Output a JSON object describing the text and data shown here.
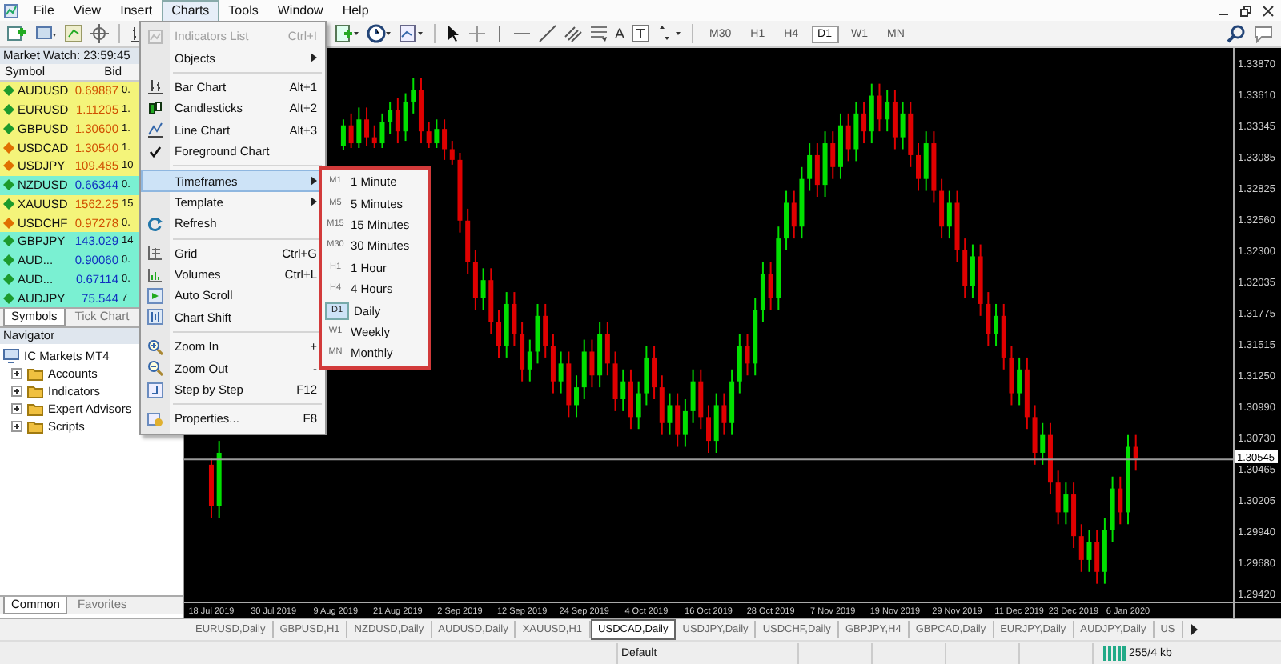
{
  "menu_bar": [
    {
      "label": "File",
      "selected": false
    },
    {
      "label": "View",
      "selected": false
    },
    {
      "label": "Insert",
      "selected": false
    },
    {
      "label": "Charts",
      "selected": true
    },
    {
      "label": "Tools",
      "selected": false
    },
    {
      "label": "Window",
      "selected": false
    },
    {
      "label": "Help",
      "selected": false
    }
  ],
  "toolbar": {
    "text_tool": "A",
    "timeframes": [
      {
        "label": "M30",
        "selected": false
      },
      {
        "label": "H1",
        "selected": false
      },
      {
        "label": "H4",
        "selected": false
      },
      {
        "label": "D1",
        "selected": true
      },
      {
        "label": "W1",
        "selected": false
      },
      {
        "label": "MN",
        "selected": false
      }
    ]
  },
  "market_watch": {
    "title": "Market Watch: 23:59:45",
    "columns": [
      "Symbol",
      "Bid"
    ],
    "rows": [
      {
        "symbol": "AUDUSD",
        "bid": "0.69887",
        "ask": "0.",
        "color": "#f4f47a",
        "marker": {
          "color": "#1c9a2c"
        }
      },
      {
        "symbol": "EURUSD",
        "bid": "1.11205",
        "ask": "1.",
        "color": "#f4f47a",
        "marker": {
          "color": "#1c9a2c"
        }
      },
      {
        "symbol": "GBPUSD",
        "bid": "1.30600",
        "ask": "1.",
        "color": "#f4f47a",
        "marker": {
          "color": "#1c9a2c"
        }
      },
      {
        "symbol": "USDCAD",
        "bid": "1.30540",
        "ask": "1.",
        "color": "#f4f47a",
        "marker": {
          "color": "#e07000"
        }
      },
      {
        "symbol": "USDJPY",
        "bid": "109.485",
        "ask": "10",
        "color": "#f4f47a",
        "marker": {
          "color": "#e07000"
        }
      },
      {
        "symbol": "NZDUSD",
        "bid": "0.66344",
        "ask": "0.",
        "color": "#7af0d2",
        "marker": {
          "color": "#1c9a2c"
        }
      },
      {
        "symbol": "XAUUSD",
        "bid": "1562.25",
        "ask": "15",
        "color": "#f4f47a",
        "marker": {
          "color": "#1c9a2c"
        }
      },
      {
        "symbol": "USDCHF",
        "bid": "0.97278",
        "ask": "0.",
        "color": "#f4f47a",
        "marker": {
          "color": "#e07000"
        }
      },
      {
        "symbol": "GBPJPY",
        "bid": "143.029",
        "ask": "14",
        "color": "#7af0d2",
        "marker": {
          "color": "#1c9a2c"
        }
      },
      {
        "symbol": "AUD...",
        "bid": "0.90060",
        "ask": "0.",
        "color": "#7af0d2",
        "marker": {
          "color": "#1c9a2c"
        }
      },
      {
        "symbol": "AUD...",
        "bid": "0.67114",
        "ask": "0.",
        "color": "#7af0d2",
        "marker": {
          "color": "#1c9a2c"
        }
      },
      {
        "symbol": "AUDJPY",
        "bid": "75.544",
        "ask": "7",
        "color": "#7af0d2",
        "marker": {
          "color": "#1c9a2c"
        }
      }
    ],
    "tabs": [
      {
        "label": "Symbols",
        "selected": true
      },
      {
        "label": "Tick Chart",
        "selected": false
      }
    ]
  },
  "navigator": {
    "title": "Navigator",
    "tree": [
      {
        "label": "IC Markets MT4",
        "children": [
          {
            "label": "Accounts",
            "expanded": false
          },
          {
            "label": "Indicators",
            "expanded": false
          },
          {
            "label": "Expert Advisors",
            "expanded": false
          },
          {
            "label": "Scripts",
            "expanded": false
          }
        ]
      }
    ],
    "tabs": [
      {
        "label": "Common",
        "selected": true
      },
      {
        "label": "Favorites",
        "selected": false
      }
    ]
  },
  "charts_menu": [
    {
      "kind": "item",
      "label": "Indicators List",
      "shortcut": "Ctrl+I",
      "disabled": true,
      "checked": false,
      "selected": false,
      "submenu": false
    },
    {
      "kind": "item",
      "label": "Objects",
      "disabled": false,
      "checked": false,
      "selected": false,
      "submenu": true
    },
    {
      "kind": "separator"
    },
    {
      "kind": "item",
      "label": "Bar Chart",
      "shortcut": "Alt+1",
      "disabled": false,
      "checked": false,
      "selected": false,
      "submenu": false
    },
    {
      "kind": "item",
      "label": "Candlesticks",
      "shortcut": "Alt+2",
      "disabled": false,
      "checked": false,
      "selected": false,
      "submenu": false
    },
    {
      "kind": "item",
      "label": "Line Chart",
      "shortcut": "Alt+3",
      "disabled": false,
      "checked": false,
      "selected": false,
      "submenu": false
    },
    {
      "kind": "item",
      "label": "Foreground Chart",
      "disabled": false,
      "checked": true,
      "selected": false,
      "submenu": false
    },
    {
      "kind": "separator"
    },
    {
      "kind": "item",
      "label": "Timeframes",
      "disabled": false,
      "checked": false,
      "selected": true,
      "submenu": true
    },
    {
      "kind": "item",
      "label": "Template",
      "disabled": false,
      "checked": false,
      "selected": false,
      "submenu": true
    },
    {
      "kind": "item",
      "label": "Refresh",
      "disabled": false,
      "checked": false,
      "selected": false,
      "submenu": false
    },
    {
      "kind": "separator"
    },
    {
      "kind": "item",
      "label": "Grid",
      "shortcut": "Ctrl+G",
      "disabled": false,
      "checked": false,
      "selected": false,
      "submenu": false
    },
    {
      "kind": "item",
      "label": "Volumes",
      "shortcut": "Ctrl+L",
      "disabled": false,
      "checked": false,
      "selected": false,
      "submenu": false
    },
    {
      "kind": "item",
      "label": "Auto Scroll",
      "disabled": false,
      "checked": false,
      "selected": false,
      "submenu": false
    },
    {
      "kind": "item",
      "label": "Chart Shift",
      "disabled": false,
      "checked": false,
      "selected": false,
      "submenu": false
    },
    {
      "kind": "separator"
    },
    {
      "kind": "item",
      "label": "Zoom In",
      "shortcut": "+",
      "disabled": false,
      "checked": false,
      "selected": false,
      "submenu": false
    },
    {
      "kind": "item",
      "label": "Zoom Out",
      "shortcut": "-",
      "disabled": false,
      "checked": false,
      "selected": false,
      "submenu": false
    },
    {
      "kind": "item",
      "label": "Step by Step",
      "shortcut": "F12",
      "disabled": false,
      "checked": false,
      "selected": false,
      "submenu": false
    },
    {
      "kind": "separator"
    },
    {
      "kind": "item",
      "label": "Properties...",
      "shortcut": "F8",
      "disabled": false,
      "checked": false,
      "selected": false,
      "submenu": false
    }
  ],
  "timeframes_submenu": [
    {
      "code": "M1",
      "label": "1 Minute",
      "selected": false
    },
    {
      "code": "M5",
      "label": "5 Minutes",
      "selected": false
    },
    {
      "code": "M15",
      "label": "15 Minutes",
      "selected": false
    },
    {
      "code": "M30",
      "label": "30 Minutes",
      "selected": false
    },
    {
      "code": "H1",
      "label": "1 Hour",
      "selected": false
    },
    {
      "code": "H4",
      "label": "4 Hours",
      "selected": false
    },
    {
      "code": "D1",
      "label": "Daily",
      "selected": true
    },
    {
      "code": "W1",
      "label": "Weekly",
      "selected": false
    },
    {
      "code": "MN",
      "label": "Monthly",
      "selected": false
    }
  ],
  "chart": {
    "chart_data": {
      "type": "candlestick",
      "ylim": [
        1.2935,
        1.34
      ],
      "categories": [
        null,
        null,
        null,
        "18 Jul 2019",
        null,
        null,
        null,
        null,
        null,
        null,
        null,
        "30 Jul 2019",
        null,
        null,
        null,
        null,
        null,
        null,
        null,
        "9 Aug 2019",
        null,
        null,
        null,
        null,
        null,
        null,
        null,
        "21 Aug 2019",
        null,
        null,
        null,
        null,
        null,
        null,
        null,
        "2 Sep 2019",
        null,
        null,
        null,
        null,
        null,
        null,
        null,
        "12 Sep 2019",
        null,
        null,
        null,
        null,
        null,
        null,
        null,
        "24 Sep 2019",
        null,
        null,
        null,
        null,
        null,
        null,
        null,
        "4 Oct 2019",
        null,
        null,
        null,
        null,
        null,
        null,
        null,
        "16 Oct 2019",
        null,
        null,
        null,
        null,
        null,
        null,
        null,
        "28 Oct 2019",
        null,
        null,
        null,
        null,
        null,
        null,
        null,
        "7 Nov 2019",
        null,
        null,
        null,
        null,
        null,
        null,
        null,
        "19 Nov 2019",
        null,
        null,
        null,
        null,
        null,
        null,
        null,
        "29 Nov 2019",
        null,
        null,
        null,
        null,
        null,
        null,
        null,
        "11 Dec 2019",
        null,
        null,
        null,
        null,
        null,
        null,
        "23 Dec 2019",
        null,
        null,
        null,
        null,
        null,
        null,
        "6 Jan 2020",
        null,
        null,
        null,
        null,
        null,
        null,
        null,
        null,
        null,
        null,
        null,
        null,
        null
      ],
      "yticks": [
        {
          "value": 1.3387,
          "label": "1.33870"
        },
        {
          "value": 1.3361,
          "label": "1.33610"
        },
        {
          "value": 1.33345,
          "label": "1.33345"
        },
        {
          "value": 1.33085,
          "label": "1.33085"
        },
        {
          "value": 1.32825,
          "label": "1.32825"
        },
        {
          "value": 1.3256,
          "label": "1.32560"
        },
        {
          "value": 1.323,
          "label": "1.32300"
        },
        {
          "value": 1.32035,
          "label": "1.32035"
        },
        {
          "value": 1.31775,
          "label": "1.31775"
        },
        {
          "value": 1.31515,
          "label": "1.31515"
        },
        {
          "value": 1.3125,
          "label": "1.31250"
        },
        {
          "value": 1.3099,
          "label": "1.30990"
        },
        {
          "value": 1.3073,
          "label": "1.30730"
        },
        {
          "value": 1.30465,
          "label": "1.30465"
        },
        {
          "value": 1.30205,
          "label": "1.30205"
        },
        {
          "value": 1.2994,
          "label": "1.29940"
        },
        {
          "value": 1.2968,
          "label": "1.29680"
        },
        {
          "value": 1.2942,
          "label": "1.29420"
        }
      ],
      "ref_lines": [
        {
          "axis": "y",
          "value": 1.30545,
          "label": "1.30545"
        }
      ],
      "ohlc": [
        null,
        null,
        null,
        [
          1.305,
          1.3055,
          1.3005,
          1.3015
        ],
        [
          1.3015,
          1.307,
          1.3005,
          1.306
        ],
        null,
        null,
        null,
        null,
        null,
        null,
        null,
        null,
        null,
        null,
        null,
        null,
        null,
        null,
        null,
        [
          1.3318,
          1.334,
          1.3314,
          1.3335
        ],
        [
          1.3335,
          1.3345,
          1.3316,
          1.332
        ],
        [
          1.332,
          1.335,
          1.3316,
          1.334
        ],
        [
          1.334,
          1.335,
          1.3318,
          1.3325
        ],
        [
          1.3325,
          1.3335,
          1.3316,
          1.332
        ],
        [
          1.332,
          1.3345,
          1.3316,
          1.3338
        ],
        [
          1.3338,
          1.3355,
          1.3328,
          1.3348
        ],
        [
          1.3348,
          1.3358,
          1.332,
          1.333
        ],
        [
          1.333,
          1.3362,
          1.3322,
          1.3355
        ],
        [
          1.3355,
          1.3375,
          1.3345,
          1.3365
        ],
        [
          1.3365,
          1.3375,
          1.332,
          1.333
        ],
        [
          1.333,
          1.3338,
          1.3316,
          1.332
        ],
        [
          1.332,
          1.334,
          1.3316,
          1.3332
        ],
        [
          1.3332,
          1.334,
          1.3306,
          1.3315
        ],
        [
          1.3315,
          1.3322,
          1.3302,
          1.3306
        ],
        [
          1.3306,
          1.3312,
          1.3245,
          1.3255
        ],
        [
          1.3255,
          1.3265,
          1.321,
          1.322
        ],
        [
          1.322,
          1.323,
          1.318,
          1.319
        ],
        [
          1.319,
          1.3215,
          1.318,
          1.3205
        ],
        [
          1.3205,
          1.3215,
          1.316,
          1.317
        ],
        [
          1.317,
          1.318,
          1.314,
          1.315
        ],
        [
          1.315,
          1.3195,
          1.314,
          1.3185
        ],
        [
          1.3185,
          1.3195,
          1.315,
          1.316
        ],
        [
          1.316,
          1.317,
          1.312,
          1.313
        ],
        [
          1.313,
          1.3155,
          1.312,
          1.3145
        ],
        [
          1.3145,
          1.3185,
          1.3135,
          1.3175
        ],
        [
          1.3175,
          1.3185,
          1.314,
          1.315
        ],
        [
          1.315,
          1.316,
          1.311,
          1.312
        ],
        [
          1.312,
          1.3145,
          1.311,
          1.3135
        ],
        [
          1.3135,
          1.3145,
          1.309,
          1.31
        ],
        [
          1.31,
          1.3125,
          1.309,
          1.3115
        ],
        [
          1.3115,
          1.3155,
          1.3105,
          1.3145
        ],
        [
          1.3145,
          1.3155,
          1.3115,
          1.3125
        ],
        [
          1.3125,
          1.317,
          1.3115,
          1.316
        ],
        [
          1.316,
          1.317,
          1.3125,
          1.3135
        ],
        [
          1.3135,
          1.3145,
          1.3095,
          1.3105
        ],
        [
          1.3105,
          1.313,
          1.3095,
          1.312
        ],
        [
          1.312,
          1.313,
          1.308,
          1.309
        ],
        [
          1.309,
          1.312,
          1.308,
          1.311
        ],
        [
          1.311,
          1.315,
          1.31,
          1.314
        ],
        [
          1.314,
          1.315,
          1.3105,
          1.3115
        ],
        [
          1.3115,
          1.3125,
          1.3075,
          1.3085
        ],
        [
          1.3085,
          1.311,
          1.3075,
          1.31
        ],
        [
          1.31,
          1.311,
          1.3065,
          1.3075
        ],
        [
          1.3075,
          1.3105,
          1.3065,
          1.3095
        ],
        [
          1.3095,
          1.313,
          1.3085,
          1.312
        ],
        [
          1.312,
          1.313,
          1.308,
          1.309
        ],
        [
          1.309,
          1.31,
          1.306,
          1.307
        ],
        [
          1.307,
          1.311,
          1.306,
          1.31
        ],
        [
          1.31,
          1.311,
          1.3075,
          1.3085
        ],
        [
          1.3085,
          1.313,
          1.3075,
          1.312
        ],
        [
          1.312,
          1.316,
          1.311,
          1.315
        ],
        [
          1.315,
          1.316,
          1.3125,
          1.3135
        ],
        [
          1.3135,
          1.319,
          1.3125,
          1.318
        ],
        [
          1.318,
          1.322,
          1.317,
          1.321
        ],
        [
          1.321,
          1.322,
          1.318,
          1.319
        ],
        [
          1.319,
          1.325,
          1.318,
          1.324
        ],
        [
          1.324,
          1.328,
          1.323,
          1.327
        ],
        [
          1.327,
          1.328,
          1.324,
          1.325
        ],
        [
          1.325,
          1.33,
          1.324,
          1.329
        ],
        [
          1.329,
          1.332,
          1.328,
          1.331
        ],
        [
          1.331,
          1.332,
          1.3275,
          1.3285
        ],
        [
          1.3285,
          1.333,
          1.3275,
          1.332
        ],
        [
          1.332,
          1.333,
          1.329,
          1.33
        ],
        [
          1.33,
          1.3345,
          1.329,
          1.3335
        ],
        [
          1.3335,
          1.3345,
          1.3305,
          1.3315
        ],
        [
          1.3315,
          1.3355,
          1.3305,
          1.3345
        ],
        [
          1.3345,
          1.3355,
          1.332,
          1.333
        ],
        [
          1.333,
          1.337,
          1.332,
          1.336
        ],
        [
          1.336,
          1.337,
          1.333,
          1.334
        ],
        [
          1.334,
          1.3365,
          1.333,
          1.3355
        ],
        [
          1.3355,
          1.3365,
          1.3315,
          1.3325
        ],
        [
          1.3325,
          1.3355,
          1.3315,
          1.3345
        ],
        [
          1.3345,
          1.3355,
          1.33,
          1.331
        ],
        [
          1.331,
          1.332,
          1.328,
          1.329
        ],
        [
          1.329,
          1.333,
          1.328,
          1.332
        ],
        [
          1.332,
          1.333,
          1.327,
          1.328
        ],
        [
          1.328,
          1.329,
          1.324,
          1.325
        ],
        [
          1.325,
          1.328,
          1.324,
          1.327
        ],
        [
          1.327,
          1.328,
          1.322,
          1.323
        ],
        [
          1.323,
          1.324,
          1.319,
          1.32
        ],
        [
          1.32,
          1.3235,
          1.319,
          1.3225
        ],
        [
          1.3225,
          1.3235,
          1.3175,
          1.3185
        ],
        [
          1.3185,
          1.3195,
          1.315,
          1.316
        ],
        [
          1.316,
          1.3185,
          1.315,
          1.3175
        ],
        [
          1.3175,
          1.3185,
          1.313,
          1.314
        ],
        [
          1.314,
          1.315,
          1.31,
          1.311
        ],
        [
          1.311,
          1.314,
          1.31,
          1.313
        ],
        [
          1.313,
          1.314,
          1.308,
          1.309
        ],
        [
          1.309,
          1.31,
          1.305,
          1.306
        ],
        [
          1.306,
          1.3085,
          1.305,
          1.3075
        ],
        [
          1.3075,
          1.3085,
          1.3025,
          1.3035
        ],
        [
          1.3035,
          1.3045,
          1.3,
          1.301
        ],
        [
          1.301,
          1.3035,
          1.3,
          1.3025
        ],
        [
          1.3025,
          1.3035,
          1.298,
          1.299
        ],
        [
          1.299,
          1.3,
          1.296,
          1.297
        ],
        [
          1.297,
          1.2995,
          1.296,
          1.2985
        ],
        [
          1.2985,
          1.2995,
          1.295,
          1.296
        ],
        [
          1.296,
          1.3005,
          1.295,
          1.2995
        ],
        [
          1.2995,
          1.304,
          1.2985,
          1.303
        ],
        [
          1.303,
          1.304,
          1.3,
          1.301
        ],
        [
          1.301,
          1.3075,
          1.3,
          1.3065
        ],
        [
          1.3065,
          1.3075,
          1.3045,
          1.3055
        ],
        null,
        null,
        null,
        null,
        null,
        null,
        null,
        null,
        null,
        null,
        null,
        null
      ]
    }
  },
  "chart_tabs": [
    {
      "label": "EURUSD,Daily",
      "selected": false
    },
    {
      "label": "GBPUSD,H1",
      "selected": false
    },
    {
      "label": "NZDUSD,Daily",
      "selected": false
    },
    {
      "label": "AUDUSD,Daily",
      "selected": false
    },
    {
      "label": "XAUUSD,H1",
      "selected": false
    },
    {
      "label": "USDCAD,Daily",
      "selected": true
    },
    {
      "label": "USDJPY,Daily",
      "selected": false
    },
    {
      "label": "USDCHF,Daily",
      "selected": false
    },
    {
      "label": "GBPJPY,H4",
      "selected": false
    },
    {
      "label": "GBPCAD,Daily",
      "selected": false
    },
    {
      "label": "EURJPY,Daily",
      "selected": false
    },
    {
      "label": "AUDJPY,Daily",
      "selected": false
    },
    {
      "label": "US",
      "selected": false
    }
  ],
  "status_bar": {
    "profile": "Default",
    "traffic": "255/4 kb"
  }
}
